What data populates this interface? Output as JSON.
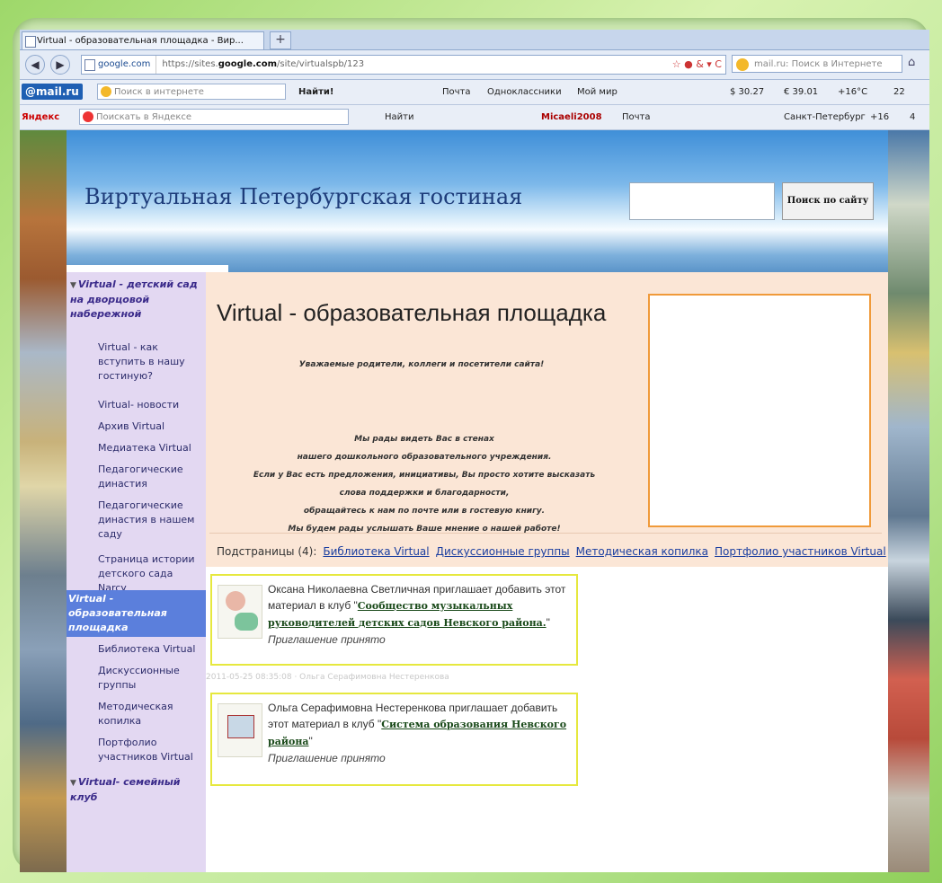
{
  "browser": {
    "tab_title": "Virtual - образовательная площадка - Вир...",
    "new_tab": "+",
    "site_label": "google.com",
    "url_prefix": "https://sites.",
    "url_bold": "google.com",
    "url_rest": "/site/virtualspb/123",
    "search_placeholder": "mail.ru: Поиск в Интернете"
  },
  "toolbar_mailru": {
    "logo": "@mail.ru",
    "search_placeholder": "Поиск в интернете",
    "find": "Найти!",
    "mail": "Почта",
    "odnoklassniki": "Одноклассники",
    "moimir": "Мой мир",
    "currency_usd": "$ 30.27",
    "currency_eur": "€ 39.01",
    "weather": "+16°C",
    "count": "22"
  },
  "toolbar_yandex": {
    "logo": "Яндекс",
    "search_placeholder": "Поискать в Яндексе",
    "find": "Найти",
    "user": "Micaeli2008",
    "mail": "Почта",
    "city": "Санкт-Петербург",
    "temp": "+16",
    "count": "4"
  },
  "site": {
    "title": "Виртуальная Петербургская гостиная",
    "search_button": "Поиск по сайту"
  },
  "sidebar": {
    "h1": "Virtual - детский сад на дворцовой набережной",
    "s1": "Virtual - как вступить в нашу гостиную?",
    "s2": "Virtual- новости",
    "s3": "Архив Virtual",
    "s4": "Медиатека Virtual",
    "s5": "Педагогические династия",
    "s6": "Педагогические династия в нашем саду",
    "s7": "Страница истории детского сада Narcy",
    "active": "Virtual - образовательная площадка",
    "s8": "Библиотека Virtual",
    "s9": "Дискуссионные группы",
    "s10": "Методическая копилка",
    "s11": "Портфолио участников Virtual",
    "h2": "Virtual- семейный клуб"
  },
  "page": {
    "heading": "Virtual - образовательная площадка",
    "greeting": "Уважаемые родители, коллеги и посетители сайта!",
    "msg1": "Мы рады видеть Вас в стенах",
    "msg2": "нашего дошкольного образовательного учреждения.",
    "msg3": "Если у Вас есть предложения, инициативы, Вы просто хотите высказать",
    "msg4": "слова поддержки и благодарности,",
    "msg5": "обращайтесь к нам по почте или в гостевую книгу.",
    "msg6": "Мы будем рады услышать Ваше мнение о нашей работе!",
    "subpages_label": "Подстраницы (4):",
    "subpages": [
      "Библиотека Virtual",
      "Дискуссионные группы",
      "Методическая копилка",
      "Портфолио участников Virtual"
    ]
  },
  "invitations": [
    {
      "text": "Оксана Николаевна Светличная приглашает добавить этот материал в клуб \"",
      "club": "Сообщество музыкальных руководителей детских садов Невского района.",
      "tail": "\"",
      "status": "Приглашение принято"
    },
    {
      "text": "Ольга Серафимовна Нестеренкова приглашает добавить этот материал в клуб \"",
      "club": "Система образования Невского района",
      "tail": "\"",
      "status": "Приглашение принято"
    }
  ],
  "ghost_line": "2011-05-25 08:35:08 · Ольга Серафимовна Нестеренкова"
}
